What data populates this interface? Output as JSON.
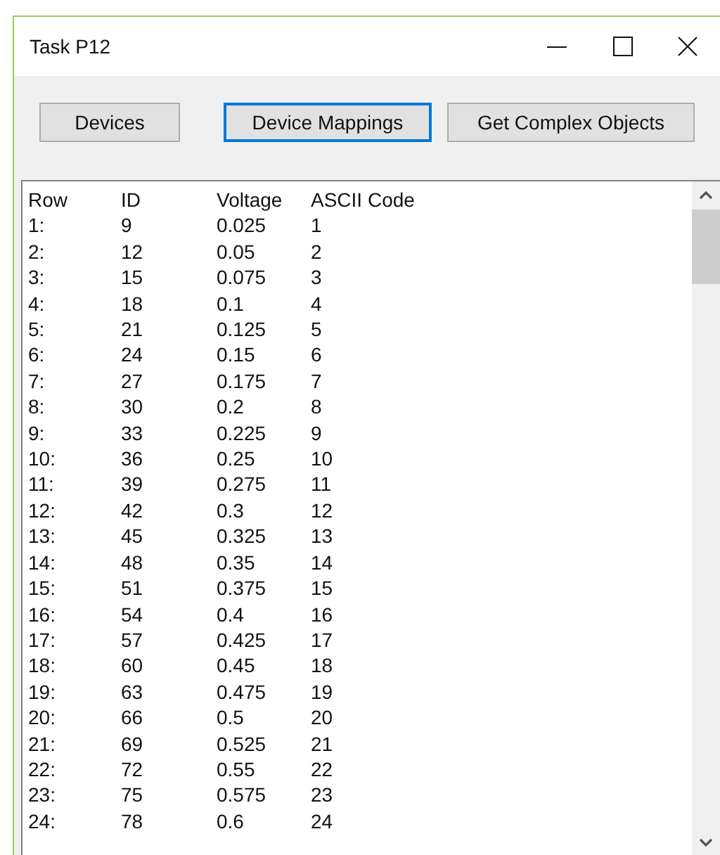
{
  "window": {
    "title": "Task P12"
  },
  "buttons": [
    {
      "label": "Devices",
      "focused": false
    },
    {
      "label": "Device Mappings",
      "focused": true
    },
    {
      "label": "Get Complex Objects",
      "focused": false
    }
  ],
  "list": {
    "columns": [
      "Row",
      "ID",
      "Voltage",
      "ASCII Code"
    ],
    "rows": [
      [
        "1:",
        "9",
        "0.025",
        "1"
      ],
      [
        "2:",
        "12",
        "0.05",
        "2"
      ],
      [
        "3:",
        "15",
        "0.075",
        "3"
      ],
      [
        "4:",
        "18",
        "0.1",
        "4"
      ],
      [
        "5:",
        "21",
        "0.125",
        "5"
      ],
      [
        "6:",
        "24",
        "0.15",
        "6"
      ],
      [
        "7:",
        "27",
        "0.175",
        "7"
      ],
      [
        "8:",
        "30",
        "0.2",
        "8"
      ],
      [
        "9:",
        "33",
        "0.225",
        "9"
      ],
      [
        "10:",
        "36",
        "0.25",
        "10"
      ],
      [
        "11:",
        "39",
        "0.275",
        "11"
      ],
      [
        "12:",
        "42",
        "0.3",
        "12"
      ],
      [
        "13:",
        "45",
        "0.325",
        "13"
      ],
      [
        "14:",
        "48",
        "0.35",
        "14"
      ],
      [
        "15:",
        "51",
        "0.375",
        "15"
      ],
      [
        "16:",
        "54",
        "0.4",
        "16"
      ],
      [
        "17:",
        "57",
        "0.425",
        "17"
      ],
      [
        "18:",
        "60",
        "0.45",
        "18"
      ],
      [
        "19:",
        "63",
        "0.475",
        "19"
      ],
      [
        "20:",
        "66",
        "0.5",
        "20"
      ],
      [
        "21:",
        "69",
        "0.525",
        "21"
      ],
      [
        "22:",
        "72",
        "0.55",
        "22"
      ],
      [
        "23:",
        "75",
        "0.575",
        "23"
      ],
      [
        "24:",
        "78",
        "0.6",
        "24"
      ]
    ]
  }
}
